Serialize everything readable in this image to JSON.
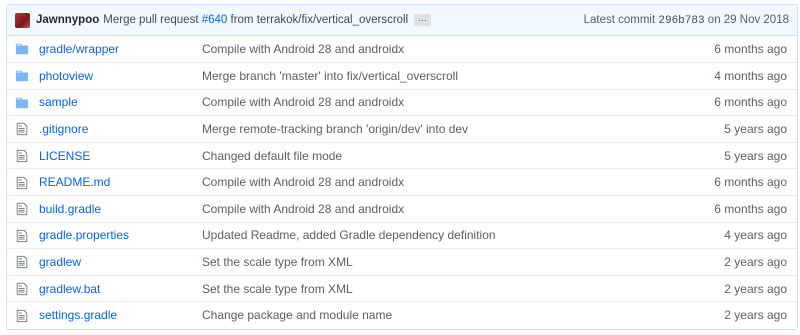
{
  "latest_commit": {
    "author": "Jawnnypoo",
    "message_prefix": "Merge pull request",
    "pr": "#640",
    "message_suffix": "from terrakok/fix/vertical_overscroll",
    "ellipsis": "…",
    "latest_label": "Latest commit",
    "sha": "296b783",
    "date": "on 29 Nov 2018"
  },
  "files": [
    {
      "type": "folder",
      "icon": "folder-icon",
      "name": "gradle/wrapper",
      "message": "Compile with Android 28 and androidx",
      "age": "6 months ago"
    },
    {
      "type": "folder",
      "icon": "folder-icon",
      "name": "photoview",
      "message": "Merge branch 'master' into fix/vertical_overscroll",
      "age": "4 months ago"
    },
    {
      "type": "folder",
      "icon": "folder-icon",
      "name": "sample",
      "message": "Compile with Android 28 and androidx",
      "age": "6 months ago"
    },
    {
      "type": "file",
      "icon": "file-icon",
      "name": ".gitignore",
      "message": "Merge remote-tracking branch 'origin/dev' into dev",
      "age": "5 years ago"
    },
    {
      "type": "file",
      "icon": "file-icon",
      "name": "LICENSE",
      "message": "Changed default file mode",
      "age": "5 years ago"
    },
    {
      "type": "file",
      "icon": "file-icon",
      "name": "README.md",
      "message": "Compile with Android 28 and androidx",
      "age": "6 months ago"
    },
    {
      "type": "file",
      "icon": "file-icon",
      "name": "build.gradle",
      "message": "Compile with Android 28 and androidx",
      "age": "6 months ago"
    },
    {
      "type": "file",
      "icon": "file-icon",
      "name": "gradle.properties",
      "message": "Updated Readme, added Gradle dependency definition",
      "age": "4 years ago"
    },
    {
      "type": "file",
      "icon": "file-icon",
      "name": "gradlew",
      "message": "Set the scale type from XML",
      "age": "2 years ago"
    },
    {
      "type": "file",
      "icon": "file-icon",
      "name": "gradlew.bat",
      "message": "Set the scale type from XML",
      "age": "2 years ago"
    },
    {
      "type": "file",
      "icon": "file-icon",
      "name": "settings.gradle",
      "message": "Change package and module name",
      "age": "2 years ago"
    }
  ],
  "colors": {
    "link": "#0366d6",
    "folder_icon": "#79b8ff",
    "file_icon": "#6a737d",
    "commit_bar_bg": "#f1f8ff"
  }
}
